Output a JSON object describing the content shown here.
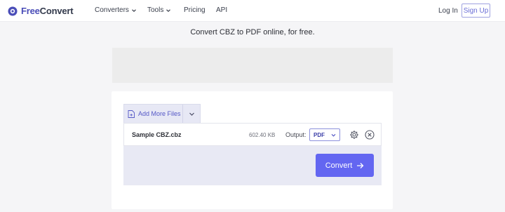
{
  "nav": {
    "brand_part1": "Free",
    "brand_part2": "Convert",
    "links": [
      "Converters",
      "Tools",
      "Pricing",
      "API"
    ],
    "login": "Log In",
    "signup": "Sign Up"
  },
  "page": {
    "headline": "Convert CBZ to PDF online, for free."
  },
  "upload": {
    "add_more_files": "Add More Files",
    "file": {
      "name": "Sample CBZ.cbz",
      "size": "602.40 KB",
      "output_label": "Output:",
      "format": "PDF"
    },
    "convert_label": "Convert"
  },
  "colors": {
    "accent": "#6366f1",
    "brand": "#4a4db8"
  }
}
